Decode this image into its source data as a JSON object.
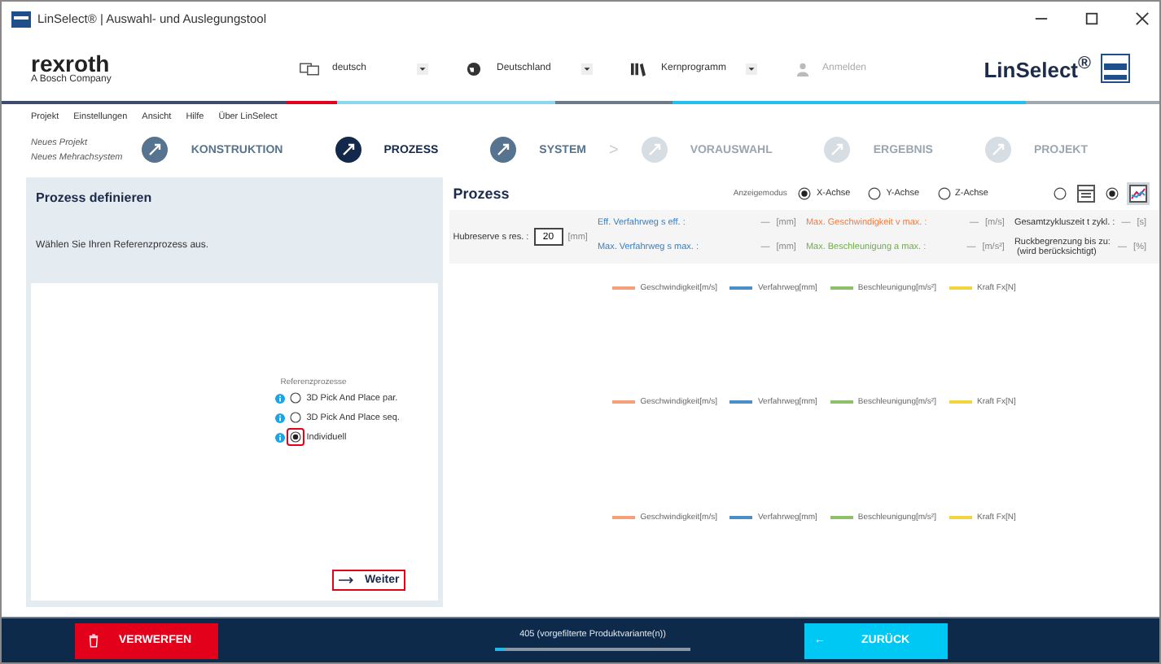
{
  "window": {
    "title": "LinSelect® | Auswahl- und Auslegungstool"
  },
  "header": {
    "brand": "rexroth",
    "brand_sub": "A Bosch Company",
    "product": "LinSelect$^{®}$",
    "selectors": [
      {
        "kind": "language",
        "value": "deutsch"
      },
      {
        "kind": "country",
        "value": "Deutschland"
      },
      {
        "kind": "program",
        "value": "Kernprogramm"
      }
    ],
    "login": {
      "label": "Anmelden",
      "disabled": true
    }
  },
  "menu": [
    "Projekt",
    "Einstellungen",
    "Ansicht",
    "Hilfe",
    "Über LinSelect"
  ],
  "project": {
    "name": "Neues Projekt",
    "system": "Neues Mehrachsystem"
  },
  "steps": [
    {
      "label": "KONSTRUKTION",
      "selected": false,
      "disabled": false
    },
    {
      "label": "PROZESS",
      "selected": true,
      "disabled": false
    },
    {
      "label": "SYSTEM",
      "selected": false,
      "disabled": false
    },
    {
      "label": "VORAUSWAHL",
      "selected": false,
      "disabled": true,
      "arrow": ">"
    },
    {
      "label": "ERGEBNIS",
      "selected": false,
      "disabled": true
    },
    {
      "label": "PROJEKT",
      "selected": false,
      "disabled": true
    }
  ],
  "left_panel": {
    "title": "Prozess definieren",
    "instruction": "Wählen Sie Ihren Referenzprozess aus.",
    "group_label": "Referenzprozesse",
    "options": [
      {
        "label": "3D Pick And Place par.",
        "selected": false,
        "highlighted": false
      },
      {
        "label": "3D Pick And Place seq.",
        "selected": false,
        "highlighted": false
      },
      {
        "label": "Individuell",
        "selected": true,
        "highlighted": true
      }
    ],
    "next_button": {
      "label": "Weiter",
      "highlighted": true
    }
  },
  "right_panel": {
    "title": "Prozess",
    "mode_label": "Anzeigemodus",
    "axes": [
      {
        "label": "X-Achse",
        "selected": true
      },
      {
        "label": "Y-Achse",
        "selected": false
      },
      {
        "label": "Z-Achse",
        "selected": false
      }
    ],
    "views": [
      {
        "kind": "table",
        "selected": false
      },
      {
        "kind": "chart",
        "selected": true
      }
    ],
    "hubreserve": {
      "label": "Hubreserve s res. :",
      "value": "20",
      "unit": "[mm]"
    },
    "params": [
      {
        "label": "Eff. Verfahrweg s eff. :",
        "value": "—",
        "unit": "[mm]",
        "color": "#3a7fc0"
      },
      {
        "label": "Max. Verfahrweg s max. :",
        "value": "—",
        "unit": "[mm]",
        "color": "#3a7fc0"
      },
      {
        "label": "Max. Geschwindigkeit v max. :",
        "value": "—",
        "unit": "[m/s]",
        "color": "#f07b3f"
      },
      {
        "label": "Max. Beschleunigung a max. :",
        "value": "—",
        "unit": "[m/s²]",
        "color": "#6fae4a"
      },
      {
        "label": "Gesamtzykluszeit t zykl. :",
        "value": "—",
        "unit": "[s]",
        "color": "#333333"
      },
      {
        "label": "Ruckbegrenzung bis zu:",
        "note": "(wird berücksichtigt)",
        "value": "—",
        "unit": "[%]",
        "color": "#333333"
      }
    ],
    "charts": [
      {
        "legend": [
          {
            "label": "Geschwindigkeit[m/s]",
            "color": "#f4a078"
          },
          {
            "label": "Verfahrweg[mm]",
            "color": "#4a8fc8"
          },
          {
            "label": "Beschleunigung[m/s²]",
            "color": "#8cc16a"
          },
          {
            "label": "Kraft Fx[N]",
            "color": "#f2d43c"
          }
        ]
      },
      {
        "legend": [
          {
            "label": "Geschwindigkeit[m/s]",
            "color": "#f4a078"
          },
          {
            "label": "Verfahrweg[mm]",
            "color": "#4a8fc8"
          },
          {
            "label": "Beschleunigung[m/s²]",
            "color": "#8cc16a"
          },
          {
            "label": "Kraft Fx[N]",
            "color": "#f2d43c"
          }
        ]
      },
      {
        "legend": [
          {
            "label": "Geschwindigkeit[m/s]",
            "color": "#f4a078"
          },
          {
            "label": "Verfahrweg[mm]",
            "color": "#4a8fc8"
          },
          {
            "label": "Beschleunigung[m/s²]",
            "color": "#8cc16a"
          },
          {
            "label": "Kraft Fx[N]",
            "color": "#f2d43c"
          }
        ]
      }
    ]
  },
  "footer": {
    "discard": "VERWERFEN",
    "variants": "405 (vorgefilterte Produktvariante(n))",
    "level": 0.05,
    "back_arrow": "←",
    "back": "ZURÜCK"
  }
}
